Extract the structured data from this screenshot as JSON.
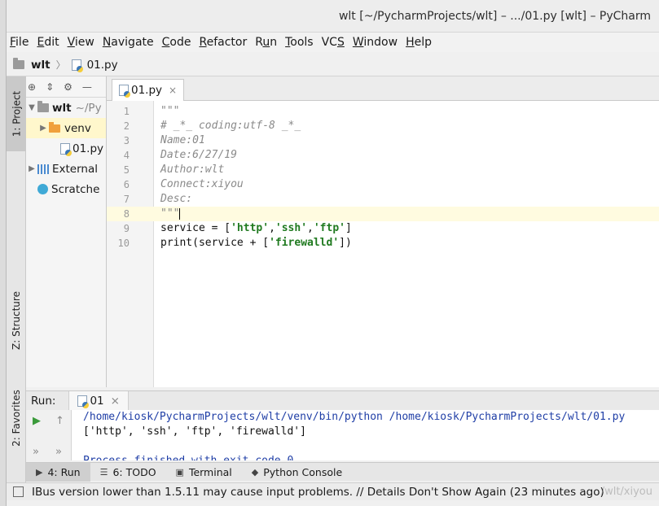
{
  "window": {
    "title": "wlt [~/PycharmProjects/wlt] – .../01.py [wlt] – PyCharm"
  },
  "menu": [
    {
      "pre": "",
      "ul": "F",
      "post": "ile"
    },
    {
      "pre": "",
      "ul": "E",
      "post": "dit"
    },
    {
      "pre": "",
      "ul": "V",
      "post": "iew"
    },
    {
      "pre": "",
      "ul": "N",
      "post": "avigate"
    },
    {
      "pre": "",
      "ul": "C",
      "post": "ode"
    },
    {
      "pre": "",
      "ul": "R",
      "post": "efactor"
    },
    {
      "pre": "R",
      "ul": "u",
      "post": "n"
    },
    {
      "pre": "",
      "ul": "T",
      "post": "ools"
    },
    {
      "pre": "VC",
      "ul": "S",
      "post": ""
    },
    {
      "pre": "",
      "ul": "W",
      "post": "indow"
    },
    {
      "pre": "",
      "ul": "H",
      "post": "elp"
    }
  ],
  "breadcrumb": {
    "project": "wlt",
    "file": "01.py"
  },
  "left_strip": {
    "project": "1: Project",
    "structure": "Z: Structure",
    "favorites": "2: Favorites"
  },
  "project_tree": [
    {
      "label": "wlt",
      "suffix": "~/Py"
    },
    {
      "label": "venv"
    },
    {
      "label": "01.py"
    },
    {
      "label": "External"
    },
    {
      "label": "Scratche"
    }
  ],
  "editor": {
    "tab": "01.py",
    "lines": [
      {
        "n": "1",
        "parts": [
          {
            "t": "\"\"\"",
            "c": "comment"
          }
        ]
      },
      {
        "n": "2",
        "parts": [
          {
            "t": "# _*_ coding:utf-8 _*_",
            "c": "comment"
          }
        ]
      },
      {
        "n": "3",
        "parts": [
          {
            "t": "Name:01",
            "c": "comment"
          }
        ]
      },
      {
        "n": "4",
        "parts": [
          {
            "t": "Date:6/27/19",
            "c": "comment"
          }
        ]
      },
      {
        "n": "5",
        "parts": [
          {
            "t": "Author:wlt",
            "c": "comment"
          }
        ]
      },
      {
        "n": "6",
        "parts": [
          {
            "t": "Connect:xiyou",
            "c": "comment"
          }
        ]
      },
      {
        "n": "7",
        "parts": [
          {
            "t": "Desc:",
            "c": "comment"
          }
        ]
      },
      {
        "n": "8",
        "parts": [
          {
            "t": "\"\"\"",
            "c": "comment"
          }
        ]
      },
      {
        "n": "9",
        "parts": [
          {
            "t": "service = [",
            "c": "plain"
          },
          {
            "t": "'http'",
            "c": "str"
          },
          {
            "t": ",",
            "c": "plain"
          },
          {
            "t": "'ssh'",
            "c": "str"
          },
          {
            "t": ",",
            "c": "plain"
          },
          {
            "t": "'ftp'",
            "c": "str"
          },
          {
            "t": "]",
            "c": "plain"
          }
        ]
      },
      {
        "n": "10",
        "parts": [
          {
            "t": "print(service + [",
            "c": "plain"
          },
          {
            "t": "'firewalld'",
            "c": "str"
          },
          {
            "t": "])",
            "c": "plain"
          }
        ]
      }
    ]
  },
  "run": {
    "label": "Run:",
    "tab": "01",
    "output": [
      {
        "text": "/home/kiosk/PycharmProjects/wlt/venv/bin/python /home/kiosk/PycharmProjects/wlt/01.py",
        "c": "blue"
      },
      {
        "text": "['http', 'ssh', 'ftp', 'firewalld']",
        "c": "dark"
      },
      {
        "text": "",
        "c": "dark"
      },
      {
        "text": "Process finished with exit code 0",
        "c": "blue"
      }
    ]
  },
  "bottom_tabs": [
    {
      "label": "4: Run",
      "icon": "play-icon"
    },
    {
      "label": "6: TODO",
      "icon": "list-icon"
    },
    {
      "label": "Terminal",
      "icon": "terminal-icon"
    },
    {
      "label": "Python Console",
      "icon": "python-icon"
    }
  ],
  "status": {
    "message": "IBus version lower than 1.5.11 may cause input problems. // Details Don't Show Again (23 minutes ago)"
  },
  "watermark": "/wlt/xiyou"
}
